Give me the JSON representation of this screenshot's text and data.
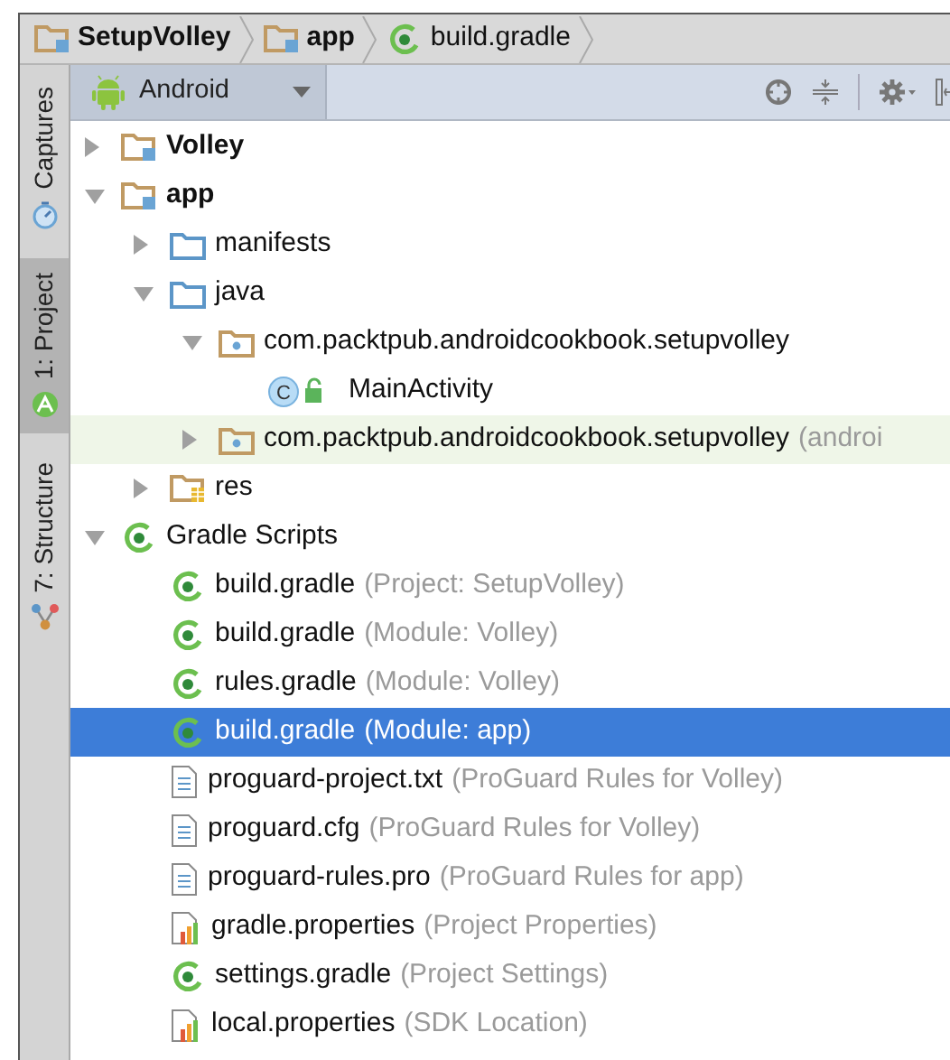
{
  "breadcrumbs": [
    {
      "label": "SetupVolley",
      "kind": "module",
      "bold": true
    },
    {
      "label": "app",
      "kind": "module",
      "bold": true
    },
    {
      "label": "build.gradle",
      "kind": "gradle",
      "bold": false
    }
  ],
  "tool_tabs": [
    {
      "label": "Captures",
      "kind": "captures",
      "selected": false
    },
    {
      "label": "1: Project",
      "kind": "project",
      "selected": true
    },
    {
      "label": "7: Structure",
      "kind": "structure",
      "selected": false
    }
  ],
  "view_selector": {
    "value": "Android"
  },
  "tree": [
    {
      "label": "Volley",
      "bold": true,
      "kind": "module",
      "expanded": false,
      "selected": false,
      "highlighted": false
    },
    {
      "label": "app",
      "bold": true,
      "kind": "module",
      "expanded": true,
      "selected": false,
      "highlighted": false,
      "children": [
        {
          "label": "manifests",
          "kind": "folder",
          "expanded": false,
          "selected": false,
          "highlighted": false
        },
        {
          "label": "java",
          "kind": "folder",
          "expanded": true,
          "selected": false,
          "highlighted": false,
          "children": [
            {
              "label": "com.packtpub.androidcookbook.setupvolley",
              "kind": "package",
              "expanded": true,
              "selected": false,
              "highlighted": false,
              "children": [
                {
                  "label": "MainActivity",
                  "icon_letter": "C",
                  "kind": "class",
                  "selected": false,
                  "highlighted": false
                }
              ]
            },
            {
              "label": "com.packtpub.androidcookbook.setupvolley",
              "hint": "(androi",
              "kind": "package",
              "expanded": false,
              "selected": false,
              "highlighted": true
            }
          ]
        },
        {
          "label": "res",
          "kind": "res",
          "expanded": false,
          "selected": false,
          "highlighted": false
        }
      ]
    },
    {
      "label": "Gradle Scripts",
      "kind": "gradle",
      "expanded": true,
      "selected": false,
      "highlighted": false,
      "children": [
        {
          "label": "build.gradle",
          "hint": "(Project: SetupVolley)",
          "kind": "gradle",
          "selected": false,
          "highlighted": false
        },
        {
          "label": "build.gradle",
          "hint": "(Module: Volley)",
          "kind": "gradle",
          "selected": false,
          "highlighted": false
        },
        {
          "label": "rules.gradle",
          "hint": "(Module: Volley)",
          "kind": "gradle",
          "selected": false,
          "highlighted": false
        },
        {
          "label": "build.gradle",
          "hint": "(Module: app)",
          "kind": "gradle",
          "selected": true,
          "highlighted": false
        },
        {
          "label": "proguard-project.txt",
          "hint": "(ProGuard Rules for Volley)",
          "kind": "file",
          "selected": false,
          "highlighted": false
        },
        {
          "label": "proguard.cfg",
          "hint": "(ProGuard Rules for Volley)",
          "kind": "file",
          "selected": false,
          "highlighted": false
        },
        {
          "label": "proguard-rules.pro",
          "hint": "(ProGuard Rules for app)",
          "kind": "file",
          "selected": false,
          "highlighted": false
        },
        {
          "label": "gradle.properties",
          "hint": "(Project Properties)",
          "kind": "properties",
          "selected": false,
          "highlighted": false
        },
        {
          "label": "settings.gradle",
          "hint": "(Project Settings)",
          "kind": "gradle",
          "selected": false,
          "highlighted": false
        },
        {
          "label": "local.properties",
          "hint": "(SDK Location)",
          "kind": "properties",
          "selected": false,
          "highlighted": false
        }
      ]
    }
  ]
}
